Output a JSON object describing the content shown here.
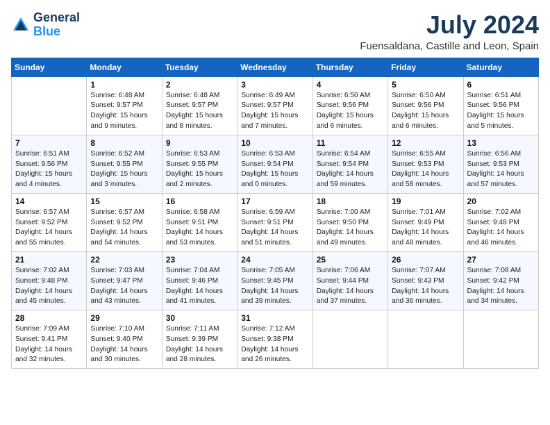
{
  "header": {
    "logo_line1": "General",
    "logo_line2": "Blue",
    "month_year": "July 2024",
    "location": "Fuensaldana, Castille and Leon, Spain"
  },
  "weekdays": [
    "Sunday",
    "Monday",
    "Tuesday",
    "Wednesday",
    "Thursday",
    "Friday",
    "Saturday"
  ],
  "weeks": [
    [
      {
        "day": "",
        "info": ""
      },
      {
        "day": "1",
        "info": "Sunrise: 6:48 AM\nSunset: 9:57 PM\nDaylight: 15 hours\nand 9 minutes."
      },
      {
        "day": "2",
        "info": "Sunrise: 6:48 AM\nSunset: 9:57 PM\nDaylight: 15 hours\nand 8 minutes."
      },
      {
        "day": "3",
        "info": "Sunrise: 6:49 AM\nSunset: 9:57 PM\nDaylight: 15 hours\nand 7 minutes."
      },
      {
        "day": "4",
        "info": "Sunrise: 6:50 AM\nSunset: 9:56 PM\nDaylight: 15 hours\nand 6 minutes."
      },
      {
        "day": "5",
        "info": "Sunrise: 6:50 AM\nSunset: 9:56 PM\nDaylight: 15 hours\nand 6 minutes."
      },
      {
        "day": "6",
        "info": "Sunrise: 6:51 AM\nSunset: 9:56 PM\nDaylight: 15 hours\nand 5 minutes."
      }
    ],
    [
      {
        "day": "7",
        "info": "Sunrise: 6:51 AM\nSunset: 9:56 PM\nDaylight: 15 hours\nand 4 minutes."
      },
      {
        "day": "8",
        "info": "Sunrise: 6:52 AM\nSunset: 9:55 PM\nDaylight: 15 hours\nand 3 minutes."
      },
      {
        "day": "9",
        "info": "Sunrise: 6:53 AM\nSunset: 9:55 PM\nDaylight: 15 hours\nand 2 minutes."
      },
      {
        "day": "10",
        "info": "Sunrise: 6:53 AM\nSunset: 9:54 PM\nDaylight: 15 hours\nand 0 minutes."
      },
      {
        "day": "11",
        "info": "Sunrise: 6:54 AM\nSunset: 9:54 PM\nDaylight: 14 hours\nand 59 minutes."
      },
      {
        "day": "12",
        "info": "Sunrise: 6:55 AM\nSunset: 9:53 PM\nDaylight: 14 hours\nand 58 minutes."
      },
      {
        "day": "13",
        "info": "Sunrise: 6:56 AM\nSunset: 9:53 PM\nDaylight: 14 hours\nand 57 minutes."
      }
    ],
    [
      {
        "day": "14",
        "info": "Sunrise: 6:57 AM\nSunset: 9:52 PM\nDaylight: 14 hours\nand 55 minutes."
      },
      {
        "day": "15",
        "info": "Sunrise: 6:57 AM\nSunset: 9:52 PM\nDaylight: 14 hours\nand 54 minutes."
      },
      {
        "day": "16",
        "info": "Sunrise: 6:58 AM\nSunset: 9:51 PM\nDaylight: 14 hours\nand 53 minutes."
      },
      {
        "day": "17",
        "info": "Sunrise: 6:59 AM\nSunset: 9:51 PM\nDaylight: 14 hours\nand 51 minutes."
      },
      {
        "day": "18",
        "info": "Sunrise: 7:00 AM\nSunset: 9:50 PM\nDaylight: 14 hours\nand 49 minutes."
      },
      {
        "day": "19",
        "info": "Sunrise: 7:01 AM\nSunset: 9:49 PM\nDaylight: 14 hours\nand 48 minutes."
      },
      {
        "day": "20",
        "info": "Sunrise: 7:02 AM\nSunset: 9:48 PM\nDaylight: 14 hours\nand 46 minutes."
      }
    ],
    [
      {
        "day": "21",
        "info": "Sunrise: 7:02 AM\nSunset: 9:48 PM\nDaylight: 14 hours\nand 45 minutes."
      },
      {
        "day": "22",
        "info": "Sunrise: 7:03 AM\nSunset: 9:47 PM\nDaylight: 14 hours\nand 43 minutes."
      },
      {
        "day": "23",
        "info": "Sunrise: 7:04 AM\nSunset: 9:46 PM\nDaylight: 14 hours\nand 41 minutes."
      },
      {
        "day": "24",
        "info": "Sunrise: 7:05 AM\nSunset: 9:45 PM\nDaylight: 14 hours\nand 39 minutes."
      },
      {
        "day": "25",
        "info": "Sunrise: 7:06 AM\nSunset: 9:44 PM\nDaylight: 14 hours\nand 37 minutes."
      },
      {
        "day": "26",
        "info": "Sunrise: 7:07 AM\nSunset: 9:43 PM\nDaylight: 14 hours\nand 36 minutes."
      },
      {
        "day": "27",
        "info": "Sunrise: 7:08 AM\nSunset: 9:42 PM\nDaylight: 14 hours\nand 34 minutes."
      }
    ],
    [
      {
        "day": "28",
        "info": "Sunrise: 7:09 AM\nSunset: 9:41 PM\nDaylight: 14 hours\nand 32 minutes."
      },
      {
        "day": "29",
        "info": "Sunrise: 7:10 AM\nSunset: 9:40 PM\nDaylight: 14 hours\nand 30 minutes."
      },
      {
        "day": "30",
        "info": "Sunrise: 7:11 AM\nSunset: 9:39 PM\nDaylight: 14 hours\nand 28 minutes."
      },
      {
        "day": "31",
        "info": "Sunrise: 7:12 AM\nSunset: 9:38 PM\nDaylight: 14 hours\nand 26 minutes."
      },
      {
        "day": "",
        "info": ""
      },
      {
        "day": "",
        "info": ""
      },
      {
        "day": "",
        "info": ""
      }
    ]
  ]
}
